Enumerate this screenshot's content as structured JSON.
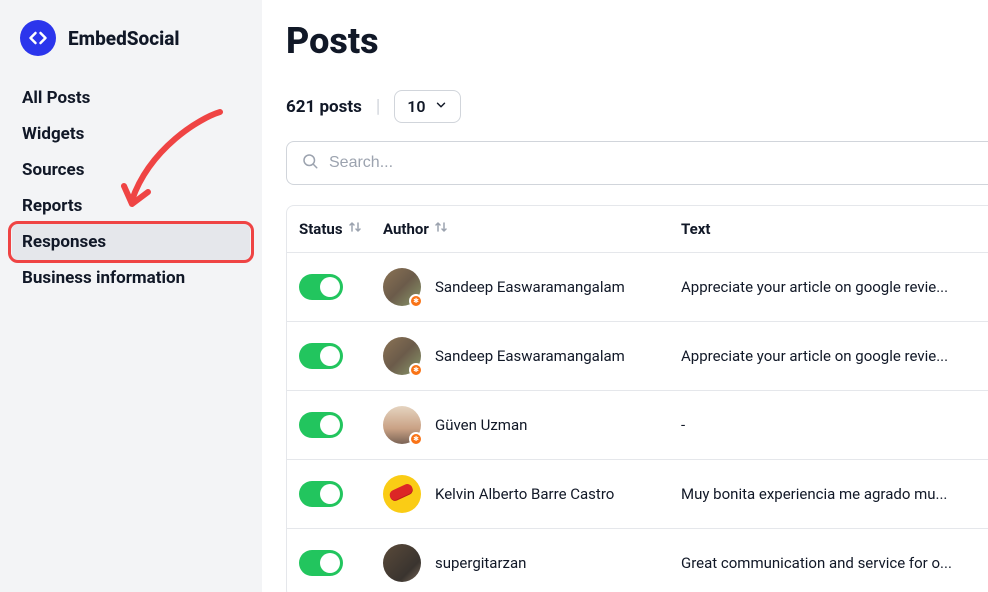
{
  "brand": "EmbedSocial",
  "sidebar": {
    "items": [
      {
        "label": "All Posts"
      },
      {
        "label": "Widgets"
      },
      {
        "label": "Sources"
      },
      {
        "label": "Reports"
      },
      {
        "label": "Responses"
      },
      {
        "label": "Business information"
      }
    ],
    "activeIndex": 4
  },
  "page": {
    "title": "Posts",
    "count": "621 posts",
    "pageSize": "10",
    "searchPlaceholder": "Search..."
  },
  "table": {
    "headers": {
      "status": "Status",
      "author": "Author",
      "text": "Text"
    },
    "rows": [
      {
        "status": true,
        "author": "Sandeep Easwaramangalam",
        "text": "Appreciate your article on google revie...",
        "avatar": "a"
      },
      {
        "status": true,
        "author": "Sandeep Easwaramangalam",
        "text": "Appreciate your article on google revie...",
        "avatar": "a"
      },
      {
        "status": true,
        "author": "Güven Uzman",
        "text": "-",
        "avatar": "b"
      },
      {
        "status": true,
        "author": "Kelvin Alberto Barre Castro",
        "text": "Muy bonita experiencia me agrado mu...",
        "avatar": "c"
      },
      {
        "status": true,
        "author": "supergitarzan",
        "text": "Great communication and service for o...",
        "avatar": "d"
      }
    ]
  }
}
